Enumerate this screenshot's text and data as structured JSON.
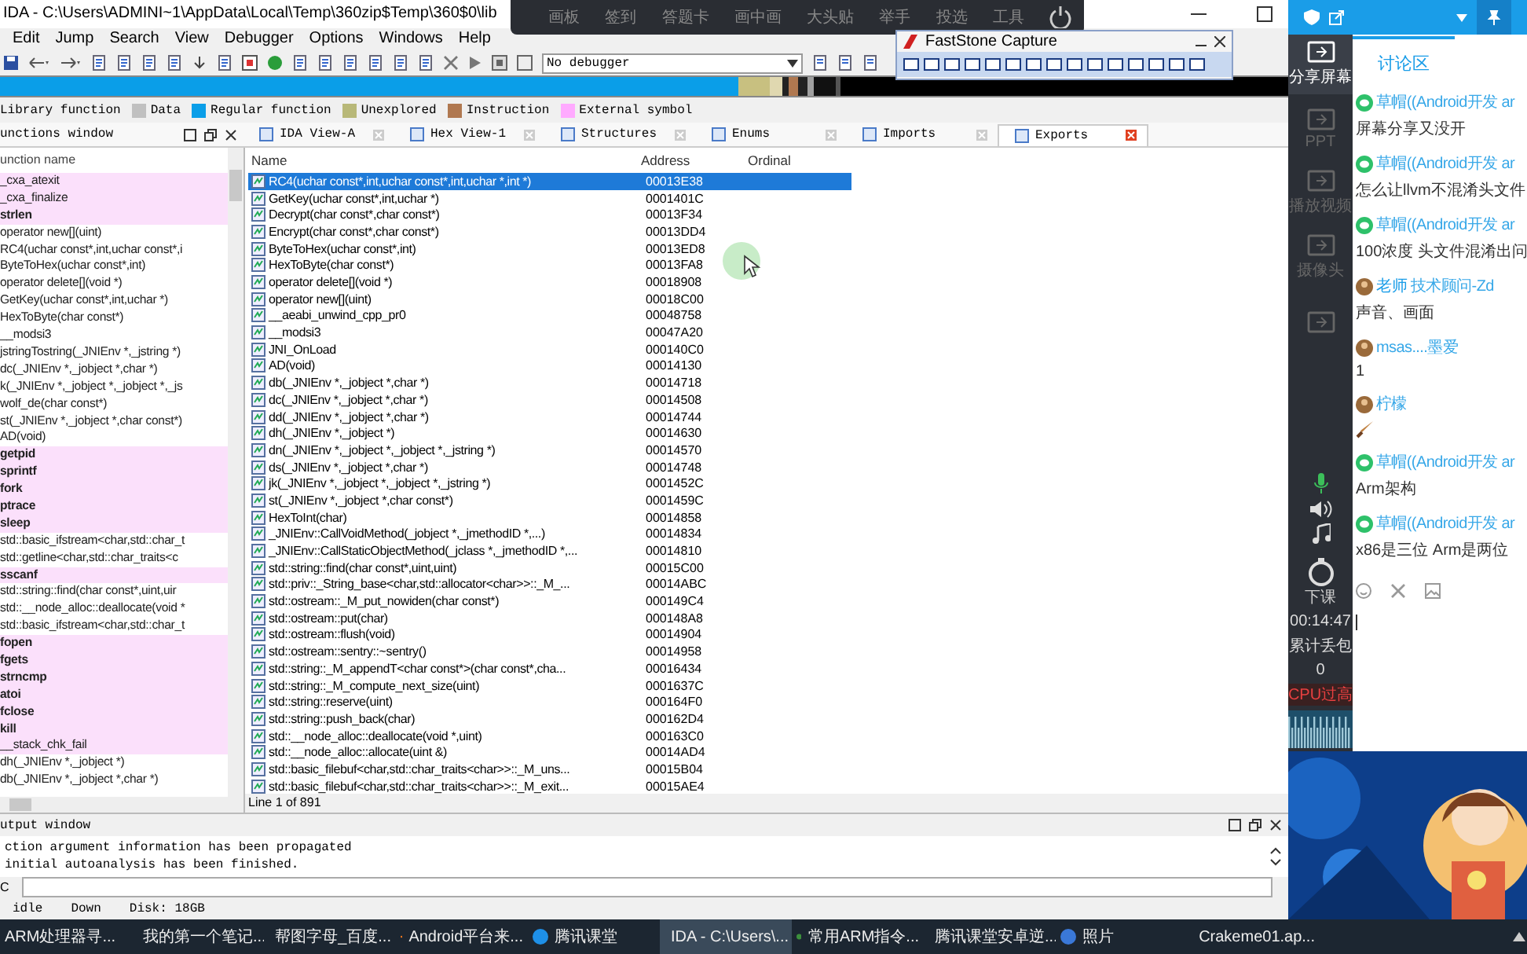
{
  "ida": {
    "title": "IDA - C:\\Users\\ADMINI~1\\AppData\\Local\\Temp\\360zip$Temp\\360$0\\lib",
    "menu": [
      "Edit",
      "Jump",
      "Search",
      "View",
      "Debugger",
      "Options",
      "Windows",
      "Help"
    ],
    "debugger": "No debugger",
    "legend": [
      {
        "label": "Library function"
      },
      {
        "label": "Data",
        "color": "#c0c0c0"
      },
      {
        "label": "Regular function",
        "color": "#0a9ee8"
      },
      {
        "label": "Unexplored",
        "color": "#b8b878"
      },
      {
        "label": "Instruction",
        "color": "#b07850"
      },
      {
        "label": "External symbol",
        "color": "#ffaaff"
      }
    ],
    "functions_window": {
      "title": "unctions window",
      "header": "unction name",
      "items": [
        {
          "name": "_cxa_atexit",
          "kind": "extern"
        },
        {
          "name": "_cxa_finalize",
          "kind": "extern"
        },
        {
          "name": "strlen",
          "kind": "import"
        },
        {
          "name": "operator new[](uint)",
          "kind": "regular"
        },
        {
          "name": "RC4(uchar const*,int,uchar const*,i",
          "kind": "regular"
        },
        {
          "name": "ByteToHex(uchar const*,int)",
          "kind": "regular"
        },
        {
          "name": "operator delete[](void *)",
          "kind": "regular"
        },
        {
          "name": "GetKey(uchar const*,int,uchar *)",
          "kind": "regular"
        },
        {
          "name": "HexToByte(char const*)",
          "kind": "regular"
        },
        {
          "name": "__modsi3",
          "kind": "regular"
        },
        {
          "name": "jstringTostring(_JNIEnv *,_jstring *)",
          "kind": "regular"
        },
        {
          "name": "dc(_JNIEnv *,_jobject *,char *)",
          "kind": "regular"
        },
        {
          "name": "k(_JNIEnv *,_jobject *,_jobject *,_js",
          "kind": "regular"
        },
        {
          "name": "wolf_de(char const*)",
          "kind": "regular"
        },
        {
          "name": "st(_JNIEnv *,_jobject *,char const*)",
          "kind": "regular"
        },
        {
          "name": "AD(void)",
          "kind": "regular"
        },
        {
          "name": "getpid",
          "kind": "import"
        },
        {
          "name": "sprintf",
          "kind": "import"
        },
        {
          "name": "fork",
          "kind": "import"
        },
        {
          "name": "ptrace",
          "kind": "import"
        },
        {
          "name": "sleep",
          "kind": "import"
        },
        {
          "name": "std::basic_ifstream<char,std::char_t",
          "kind": "regular"
        },
        {
          "name": "std::getline<char,std::char_traits<c",
          "kind": "regular"
        },
        {
          "name": "sscanf",
          "kind": "import"
        },
        {
          "name": "std::string::find(char const*,uint,uir",
          "kind": "regular"
        },
        {
          "name": "std::__node_alloc::deallocate(void *",
          "kind": "regular"
        },
        {
          "name": "std::basic_ifstream<char,std::char_t",
          "kind": "regular"
        },
        {
          "name": "fopen",
          "kind": "import"
        },
        {
          "name": "fgets",
          "kind": "import"
        },
        {
          "name": "strncmp",
          "kind": "import"
        },
        {
          "name": "atoi",
          "kind": "import"
        },
        {
          "name": "fclose",
          "kind": "import"
        },
        {
          "name": "kill",
          "kind": "import"
        },
        {
          "name": "__stack_chk_fail",
          "kind": "extern"
        },
        {
          "name": "dh(_JNIEnv *,_jobject *)",
          "kind": "regular"
        },
        {
          "name": "db(_JNIEnv *,_jobject *,char *)",
          "kind": "regular"
        }
      ]
    },
    "tabs": [
      {
        "label": "IDA View-A",
        "selected": false
      },
      {
        "label": "Hex View-1",
        "selected": false
      },
      {
        "label": "Structures",
        "selected": false
      },
      {
        "label": "Enums",
        "selected": false
      },
      {
        "label": "Imports",
        "selected": false
      },
      {
        "label": "Exports",
        "selected": true
      }
    ],
    "exports": {
      "columns": [
        "Name",
        "Address",
        "Ordinal"
      ],
      "rows": [
        {
          "name": "RC4(uchar const*,int,uchar const*,int,uchar *,int *)",
          "address": "00013E38",
          "selected": true
        },
        {
          "name": "GetKey(uchar const*,int,uchar *)",
          "address": "0001401C",
          "selected": false
        },
        {
          "name": "Decrypt(char const*,char const*)",
          "address": "00013F34",
          "selected": false
        },
        {
          "name": "Encrypt(char const*,char const*)",
          "address": "00013DD4",
          "selected": false
        },
        {
          "name": "ByteToHex(uchar const*,int)",
          "address": "00013ED8",
          "selected": false
        },
        {
          "name": "HexToByte(char const*)",
          "address": "00013FA8",
          "selected": false
        },
        {
          "name": "operator delete[](void *)",
          "address": "00018908",
          "selected": false
        },
        {
          "name": "operator new[](uint)",
          "address": "00018C00",
          "selected": false
        },
        {
          "name": "__aeabi_unwind_cpp_pr0",
          "address": "00048758",
          "selected": false
        },
        {
          "name": "__modsi3",
          "address": "00047A20",
          "selected": false
        },
        {
          "name": "JNI_OnLoad",
          "address": "000140C0",
          "selected": false
        },
        {
          "name": "AD(void)",
          "address": "00014130",
          "selected": false
        },
        {
          "name": "db(_JNIEnv *,_jobject *,char *)",
          "address": "00014718",
          "selected": false
        },
        {
          "name": "dc(_JNIEnv *,_jobject *,char *)",
          "address": "00014508",
          "selected": false
        },
        {
          "name": "dd(_JNIEnv *,_jobject *,char *)",
          "address": "00014744",
          "selected": false
        },
        {
          "name": "dh(_JNIEnv *,_jobject *)",
          "address": "00014630",
          "selected": false
        },
        {
          "name": "dn(_JNIEnv *,_jobject *,_jobject *,_jstring *)",
          "address": "00014570",
          "selected": false
        },
        {
          "name": "ds(_JNIEnv *,_jobject *,char *)",
          "address": "00014748",
          "selected": false
        },
        {
          "name": "jk(_JNIEnv *,_jobject *,_jobject *,_jstring *)",
          "address": "0001452C",
          "selected": false
        },
        {
          "name": "st(_JNIEnv *,_jobject *,char const*)",
          "address": "0001459C",
          "selected": false
        },
        {
          "name": "HexToInt(char)",
          "address": "00014858",
          "selected": false
        },
        {
          "name": "_JNIEnv::CallVoidMethod(_jobject *,_jmethodID *,...)",
          "address": "00014834",
          "selected": false
        },
        {
          "name": "_JNIEnv::CallStaticObjectMethod(_jclass *,_jmethodID *,...",
          "address": "00014810",
          "selected": false
        },
        {
          "name": "std::string::find(char const*,uint,uint)",
          "address": "00015C00",
          "selected": false
        },
        {
          "name": "std::priv::_String_base<char,std::allocator<char>>::_M_...",
          "address": "00014ABC",
          "selected": false
        },
        {
          "name": "std::ostream::_M_put_nowiden(char const*)",
          "address": "000149C4",
          "selected": false
        },
        {
          "name": "std::ostream::put(char)",
          "address": "000148A8",
          "selected": false
        },
        {
          "name": "std::ostream::flush(void)",
          "address": "00014904",
          "selected": false
        },
        {
          "name": "std::ostream::sentry::~sentry()",
          "address": "00014958",
          "selected": false
        },
        {
          "name": "std::string::_M_appendT<char const*>(char const*,cha...",
          "address": "00016434",
          "selected": false
        },
        {
          "name": "std::string::_M_compute_next_size(uint)",
          "address": "0001637C",
          "selected": false
        },
        {
          "name": "std::string::reserve(uint)",
          "address": "000164F0",
          "selected": false
        },
        {
          "name": "std::string::push_back(char)",
          "address": "000162D4",
          "selected": false
        },
        {
          "name": "std::__node_alloc::deallocate(void *,uint)",
          "address": "000163C0",
          "selected": false
        },
        {
          "name": "std::__node_alloc::allocate(uint &)",
          "address": "00014AD4",
          "selected": false
        },
        {
          "name": "std::basic_filebuf<char,std::char_traits<char>>::_M_uns...",
          "address": "00015B04",
          "selected": false
        },
        {
          "name": "std::basic_filebuf<char,std::char_traits<char>>::_M_exit...",
          "address": "00015AE4",
          "selected": false
        }
      ],
      "status": "Line 1 of 891"
    },
    "output": {
      "title": "utput window",
      "lines": [
        "ction argument information has been propagated",
        "initial autoanalysis has been finished."
      ],
      "command_label": "C",
      "status": [
        "idle",
        "Down",
        "Disk: 18GB"
      ]
    }
  },
  "class_bar": {
    "items": [
      "画板",
      "签到",
      "答题卡",
      "画中画",
      "大头贴",
      "举手",
      "投选",
      "工具"
    ]
  },
  "capture": {
    "title": "FastStone Capture"
  },
  "chat": {
    "sidebar": [
      {
        "label": "分享屏幕",
        "selected": true
      },
      {
        "label": "PPT",
        "selected": false
      },
      {
        "label": "播放视频",
        "selected": false
      },
      {
        "label": "摄像头",
        "selected": false
      },
      {
        "selected": false
      }
    ],
    "end_label": "下课",
    "timer": "00:14:47",
    "loss_label": "累计丢包",
    "loss": "0",
    "cpu_warning": "CPU过高",
    "tabs": [
      {
        "label": "讨论区",
        "selected": true
      }
    ],
    "messages": [
      {
        "sender": "草帽((Android开发 ar",
        "kind": "wechat",
        "text": "屏幕分享又没开"
      },
      {
        "sender": "草帽((Android开发 ar",
        "kind": "wechat",
        "text": "怎么让llvm不混淆头文件"
      },
      {
        "sender": "草帽((Android开发 ar",
        "kind": "wechat",
        "text": "100浓度 头文件混淆出问"
      },
      {
        "sender": "技术顾问-Zd",
        "badge": "老师",
        "kind": "member",
        "text": "声音、画面"
      },
      {
        "sender": "msas....墨爱",
        "kind": "member",
        "text": "1"
      },
      {
        "sender": "柠檬",
        "kind": "sticker"
      },
      {
        "sender": "草帽((Android开发 ar",
        "kind": "wechat",
        "text": "Arm架构"
      },
      {
        "sender": "草帽((Android开发 ar",
        "kind": "wechat",
        "text": "x86是三位  Arm是两位"
      }
    ]
  },
  "taskbar": [
    {
      "label": "ARM处理器寻...",
      "kind": "plain",
      "selected": false
    },
    {
      "label": "我的第一个笔记...",
      "kind": "green",
      "selected": false
    },
    {
      "label": "帮图字母_百度...",
      "kind": "browser",
      "selected": false
    },
    {
      "label": "Android平台来...",
      "kind": "browser",
      "selected": false
    },
    {
      "label": "腾讯课堂",
      "kind": "classroom",
      "selected": false
    },
    {
      "label": "IDA - C:\\Users\\...",
      "kind": "person",
      "selected": true
    },
    {
      "label": "常用ARM指令...",
      "kind": "web",
      "selected": false
    },
    {
      "label": "腾讯课堂安卓逆...",
      "kind": "person",
      "selected": false
    },
    {
      "label": "照片",
      "kind": "photos",
      "selected": false
    },
    {
      "label": "Crakeme01.ap...",
      "kind": "app",
      "selected": false
    }
  ]
}
